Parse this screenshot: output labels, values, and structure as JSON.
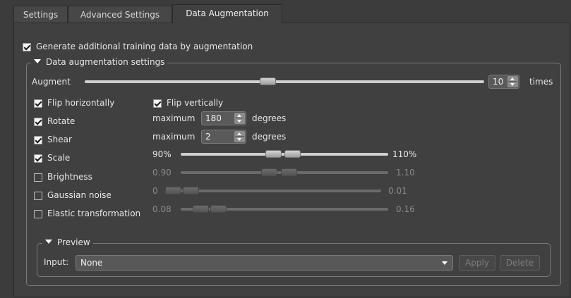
{
  "tabs": [
    {
      "label": "Settings"
    },
    {
      "label": "Advanced Settings"
    },
    {
      "label": "Data Augmentation"
    }
  ],
  "generate": {
    "label": "Generate additional training data by augmentation",
    "checked": true
  },
  "group": {
    "title": "Data augmentation settings"
  },
  "augment": {
    "label": "Augment",
    "value": "10",
    "unit": "times",
    "level": 0.5
  },
  "flip_h": {
    "label": "Flip horizontally",
    "checked": true
  },
  "flip_v": {
    "label": "Flip vertically",
    "checked": true
  },
  "rotate": {
    "label": "Rotate",
    "checked": true,
    "prefix": "maximum",
    "value": "180",
    "unit": "degrees"
  },
  "shear": {
    "label": "Shear",
    "checked": true,
    "prefix": "maximum",
    "value": "2",
    "unit": "degrees"
  },
  "scale": {
    "label": "Scale",
    "checked": true,
    "min": "90%",
    "max": "110%"
  },
  "brightness": {
    "label": "Brightness",
    "checked": false,
    "min": "0.90",
    "max": "1.10"
  },
  "noise": {
    "label": "Gaussian noise",
    "checked": false,
    "min": "0",
    "max": "0.01"
  },
  "elastic": {
    "label": "Elastic transformation",
    "checked": false,
    "min": "0.08",
    "max": "0.16"
  },
  "preview": {
    "title": "Preview",
    "input_label": "Input:",
    "input_value": "None",
    "apply_label": "Apply",
    "delete_label": "Delete"
  }
}
